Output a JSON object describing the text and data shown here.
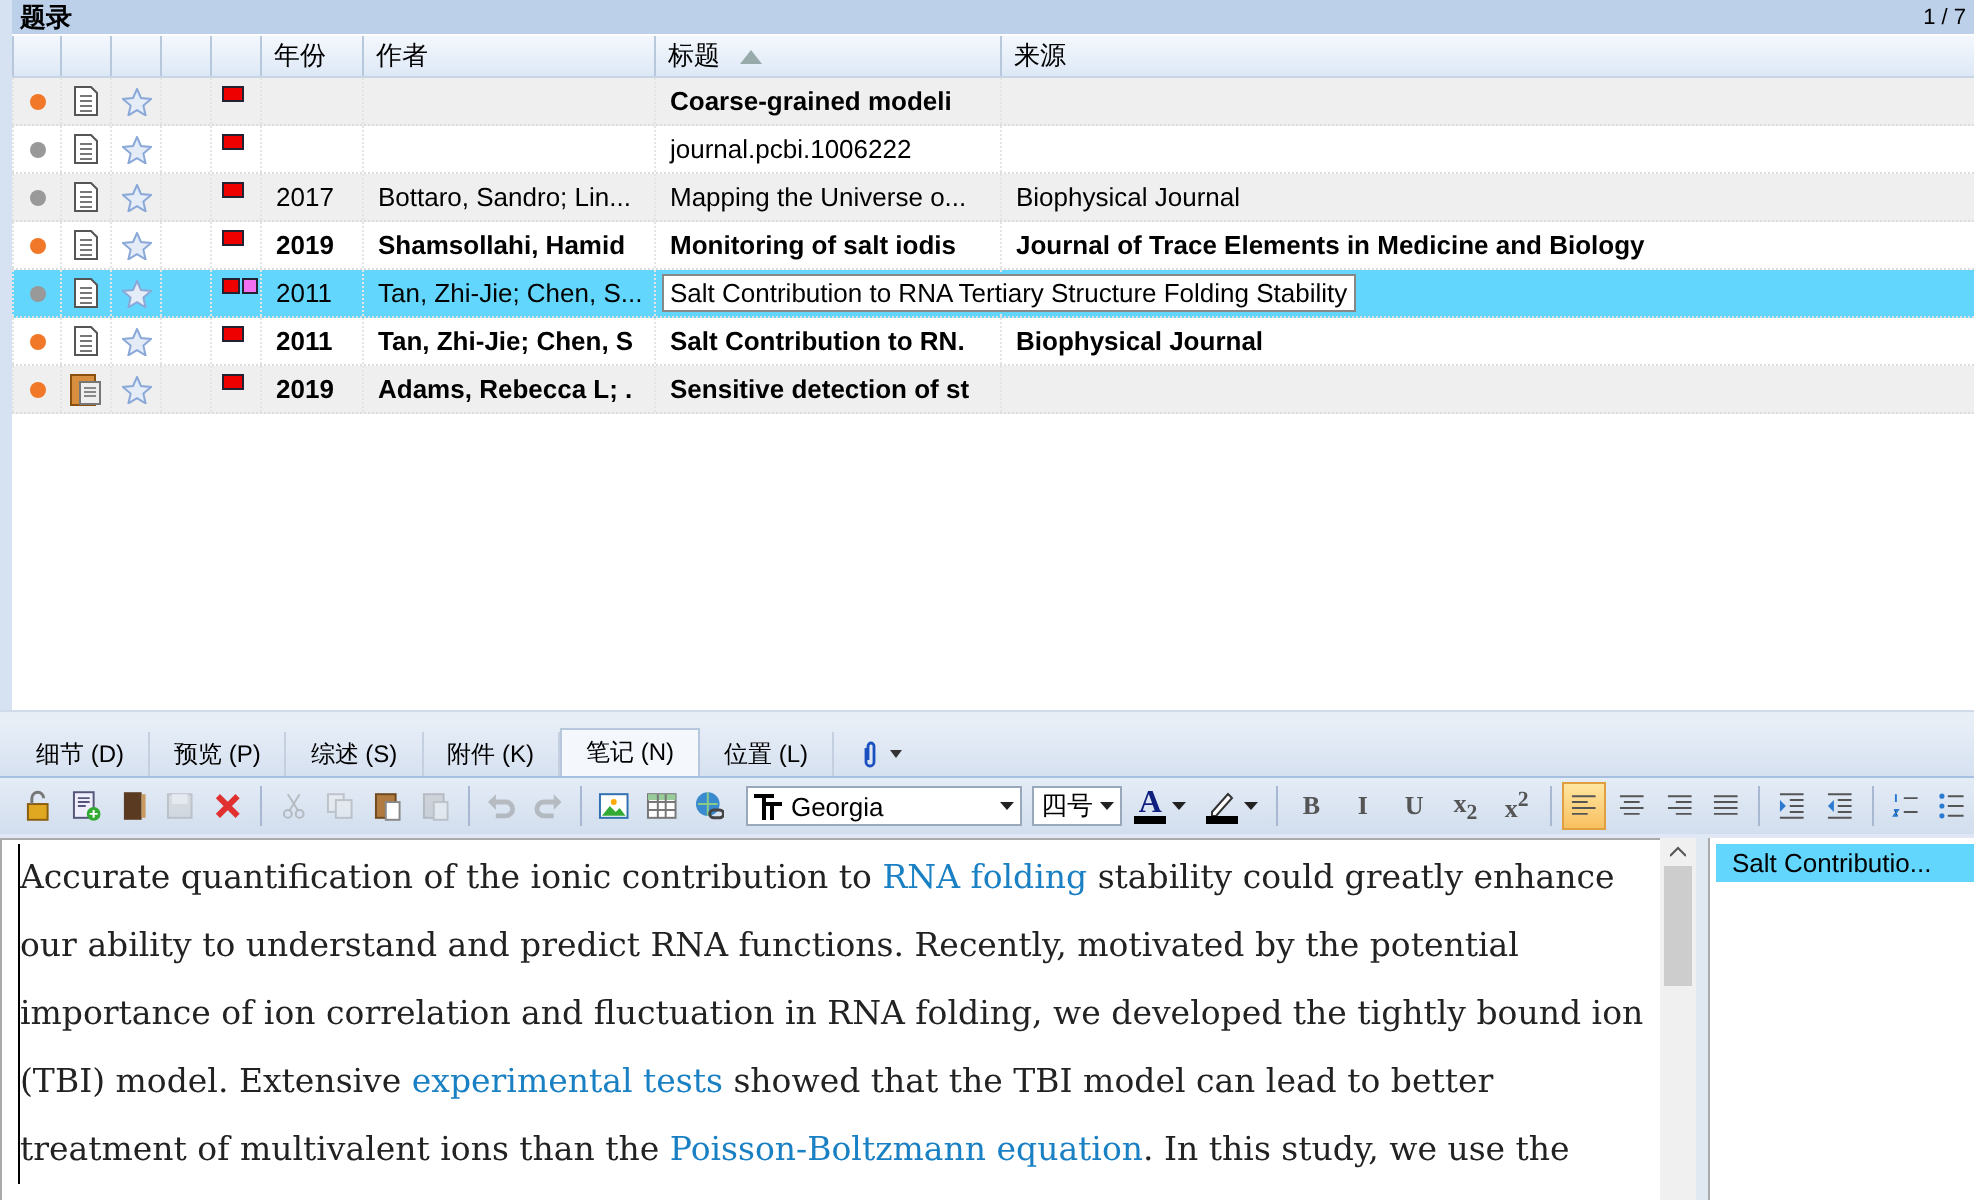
{
  "list_header": {
    "title": "题录",
    "counter": "1 / 7"
  },
  "table": {
    "columns": [
      {
        "kind": "read"
      },
      {
        "kind": "type"
      },
      {
        "kind": "star"
      },
      {
        "kind": "blank"
      },
      {
        "kind": "flags"
      },
      {
        "kind": "year",
        "label": "年份"
      },
      {
        "kind": "author",
        "label": "作者"
      },
      {
        "kind": "title",
        "label": "标题",
        "sorted": true
      },
      {
        "kind": "source",
        "label": "来源"
      }
    ],
    "rows": [
      {
        "unread": true,
        "kind": "document",
        "starred": false,
        "flags": [
          {
            "color": "#ee0000"
          }
        ],
        "title": "Coarse-grained modeli",
        "selected": false
      },
      {
        "unread": false,
        "kind": "document",
        "starred": false,
        "flags": [
          {
            "color": "#ee0000"
          }
        ],
        "title": "journal.pcbi.1006222",
        "selected": false
      },
      {
        "unread": false,
        "kind": "document",
        "starred": false,
        "flags": [
          {
            "color": "#ee0000"
          }
        ],
        "year": "2017",
        "author": "Bottaro, Sandro; Lin...",
        "title": "Mapping the Universe o...",
        "source": "Biophysical Journal",
        "selected": false
      },
      {
        "unread": true,
        "kind": "document",
        "starred": false,
        "flags": [
          {
            "color": "#ee0000"
          }
        ],
        "year": "2019",
        "author": "Shamsollahi, Hamid",
        "title": "Monitoring of salt iodis",
        "source": "Journal of Trace Elements in Medicine and Biology",
        "selected": false
      },
      {
        "unread": false,
        "kind": "document",
        "starred": false,
        "flags": [
          {
            "color": "#ee0000"
          },
          {
            "color": "#f070f0"
          }
        ],
        "year": "2011",
        "author": "Tan, Zhi-Jie; Chen, S...",
        "title": "Salt Contribution to RNA Tertiary Structure Folding Stability",
        "selected": true
      },
      {
        "unread": true,
        "kind": "document",
        "starred": false,
        "flags": [
          {
            "color": "#ee0000"
          }
        ],
        "year": "2011",
        "author": "Tan, Zhi-Jie; Chen, S",
        "title": "Salt Contribution to RN.",
        "source": "Biophysical Journal",
        "selected": false
      },
      {
        "unread": true,
        "kind": "book",
        "starred": false,
        "flags": [
          {
            "color": "#ee0000"
          }
        ],
        "year": "2019",
        "author": "Adams, Rebecca L; .",
        "title": "Sensitive detection of st",
        "selected": false
      }
    ]
  },
  "tabs": [
    {
      "label": "细节 (D)",
      "selected": false
    },
    {
      "label": "预览 (P)",
      "selected": false
    },
    {
      "label": "综述 (S)",
      "selected": false
    },
    {
      "label": "附件 (K)",
      "selected": false
    },
    {
      "label": "笔记 (N)",
      "selected": true
    },
    {
      "label": "位置 (L)",
      "selected": false
    }
  ],
  "toolbar": [
    {
      "kind": "button",
      "disabled": false
    },
    {
      "kind": "button",
      "disabled": false
    },
    {
      "kind": "button",
      "disabled": false
    },
    {
      "kind": "button",
      "disabled": true
    },
    {
      "kind": "button",
      "disabled": false
    },
    {
      "kind": "separator"
    },
    {
      "kind": "button",
      "disabled": true
    },
    {
      "kind": "button",
      "disabled": true
    },
    {
      "kind": "button",
      "disabled": false
    },
    {
      "kind": "button",
      "disabled": true
    },
    {
      "kind": "separator"
    },
    {
      "kind": "button",
      "disabled": true
    },
    {
      "kind": "button",
      "disabled": true
    },
    {
      "kind": "separator"
    },
    {
      "kind": "button",
      "disabled": false
    },
    {
      "kind": "button",
      "disabled": false
    },
    {
      "kind": "button",
      "disabled": false
    },
    {
      "kind": "font-select",
      "value": "Georgia"
    },
    {
      "kind": "size-select",
      "value": "四号"
    },
    {
      "kind": "font-color",
      "label": "A"
    },
    {
      "kind": "highlight"
    },
    {
      "kind": "separator"
    },
    {
      "kind": "format",
      "label": "B",
      "active": false
    },
    {
      "kind": "format",
      "label": "I",
      "active": false
    },
    {
      "kind": "format",
      "label": "U",
      "active": false
    },
    {
      "kind": "format",
      "label": "x$_{2}$",
      "active": false
    },
    {
      "kind": "format",
      "label": "x$^{2}$",
      "active": false
    },
    {
      "kind": "separator"
    },
    {
      "kind": "toggle",
      "active": true
    },
    {
      "kind": "toggle",
      "active": false
    },
    {
      "kind": "toggle",
      "active": false
    },
    {
      "kind": "toggle",
      "active": false
    },
    {
      "kind": "separator"
    },
    {
      "kind": "button",
      "disabled": false
    },
    {
      "kind": "button",
      "disabled": false
    },
    {
      "kind": "separator"
    },
    {
      "kind": "toggle",
      "active": false
    },
    {
      "kind": "toggle",
      "active": false
    }
  ],
  "note": {
    "segments": [
      {
        "kind": "text",
        "text": "Accurate quantification of the ionic contribution to "
      },
      {
        "kind": "link",
        "text": "RNA folding"
      },
      {
        "kind": "text",
        "text": " stability could greatly enhance our ability to understand and predict RNA functions. Recently, motivated by the potential importance of ion correlation and fluctuation in RNA folding, we developed the tightly bound ion (TBI) model. Extensive "
      },
      {
        "kind": "link",
        "text": "experimental tests"
      },
      {
        "kind": "text",
        "text": " showed that the TBI model can lead to better treatment of multivalent ions than the "
      },
      {
        "kind": "link",
        "text": "Poisson-Boltzmann equation"
      },
      {
        "kind": "text",
        "text": ". In this study, we use the"
      }
    ]
  },
  "note_list": [
    {
      "label": "Salt Contributio...",
      "selected": true
    }
  ]
}
